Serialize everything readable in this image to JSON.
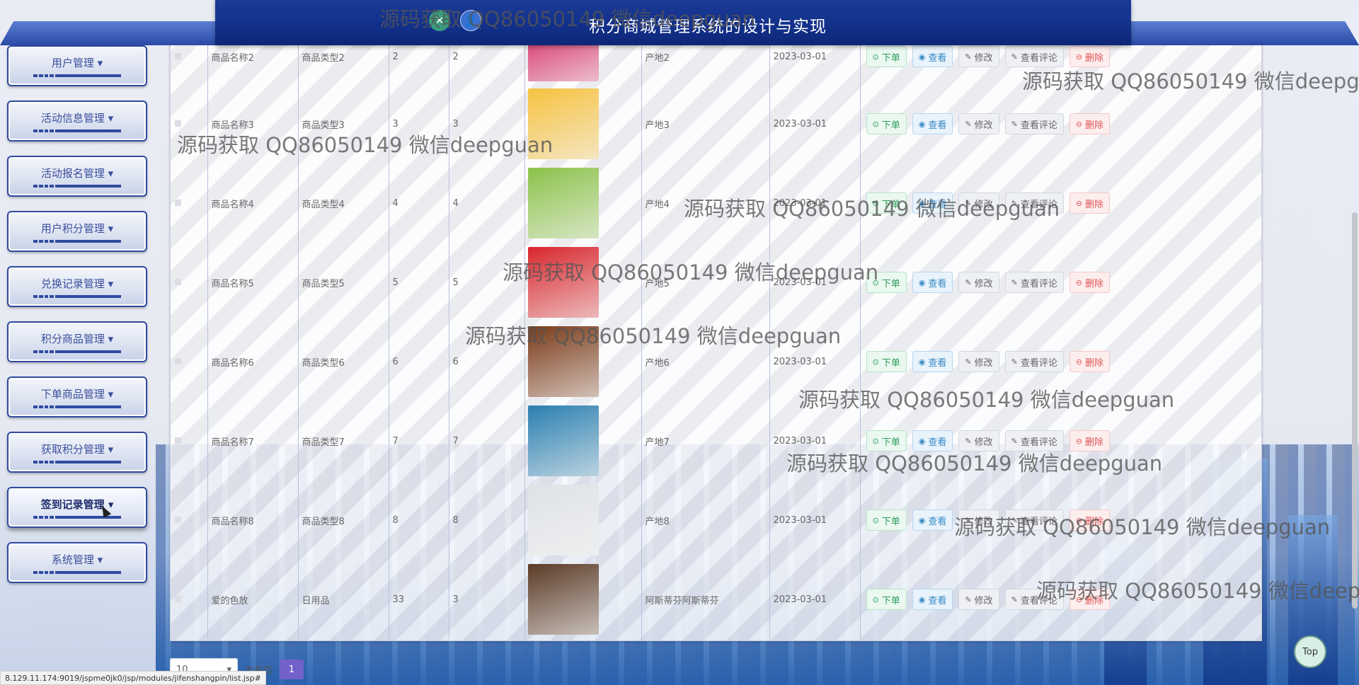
{
  "header": {
    "title": "积分商城管理系统的设计与实现",
    "icons": [
      "tool-icon",
      "user-icon"
    ]
  },
  "sidebar": {
    "items": [
      {
        "label": "用户管理 ▾"
      },
      {
        "label": "活动信息管理 ▾"
      },
      {
        "label": "活动报名管理 ▾"
      },
      {
        "label": "用户积分管理 ▾"
      },
      {
        "label": "兑换记录管理 ▾"
      },
      {
        "label": "积分商品管理 ▾"
      },
      {
        "label": "下单商品管理 ▾"
      },
      {
        "label": "获取积分管理 ▾"
      },
      {
        "label": "签到记录管理 ▾",
        "active": true
      },
      {
        "label": "系统管理 ▾"
      }
    ]
  },
  "table": {
    "rows": [
      {
        "name": "商品名称2",
        "type": "商品类型2",
        "points": "2",
        "stock": "2",
        "origin": "产地2",
        "date": "2023-03-01",
        "image_color": "#d8356e"
      },
      {
        "name": "商品名称3",
        "type": "商品类型3",
        "points": "3",
        "stock": "3",
        "origin": "产地3",
        "date": "2023-03-01",
        "image_color": "#f6c240"
      },
      {
        "name": "商品名称4",
        "type": "商品类型4",
        "points": "4",
        "stock": "4",
        "origin": "产地4",
        "date": "2023-03-01",
        "image_color": "#8cc24a"
      },
      {
        "name": "商品名称5",
        "type": "商品类型5",
        "points": "5",
        "stock": "5",
        "origin": "产地5",
        "date": "2023-03-01",
        "image_color": "#d8262c"
      },
      {
        "name": "商品名称6",
        "type": "商品类型6",
        "points": "6",
        "stock": "6",
        "origin": "产地6",
        "date": "2023-03-01",
        "image_color": "#7a3a18"
      },
      {
        "name": "商品名称7",
        "type": "商品类型7",
        "points": "7",
        "stock": "7",
        "origin": "产地7",
        "date": "2023-03-01",
        "image_color": "#2a7fb0"
      },
      {
        "name": "商品名称8",
        "type": "商品类型8",
        "points": "8",
        "stock": "8",
        "origin": "产地8",
        "date": "2023-03-01",
        "image_color": "#dfe2e6"
      },
      {
        "name": "爱的色放",
        "type": "日用品",
        "points": "33",
        "stock": "3",
        "origin": "阿斯蒂芬阿斯蒂芬",
        "date": "2023-03-01",
        "image_color": "#5a3a26"
      }
    ],
    "actions": {
      "order": "下单",
      "view": "查看",
      "edit": "修改",
      "review": "查看评论",
      "delete": "删除"
    }
  },
  "pager": {
    "page_size": "10",
    "unit": "条每页",
    "current_page": "1"
  },
  "top_button": "Top",
  "status_url": "8.129.11.174:9019/jspme0jk0/jsp/modules/jifenshangpin/list.jsp#",
  "watermark": "源码获取 QQ86050149 微信deepguan",
  "colors": {
    "header_bg": "#12308a",
    "menu_border": "#2f4aa0",
    "page_active": "#7161c8"
  }
}
